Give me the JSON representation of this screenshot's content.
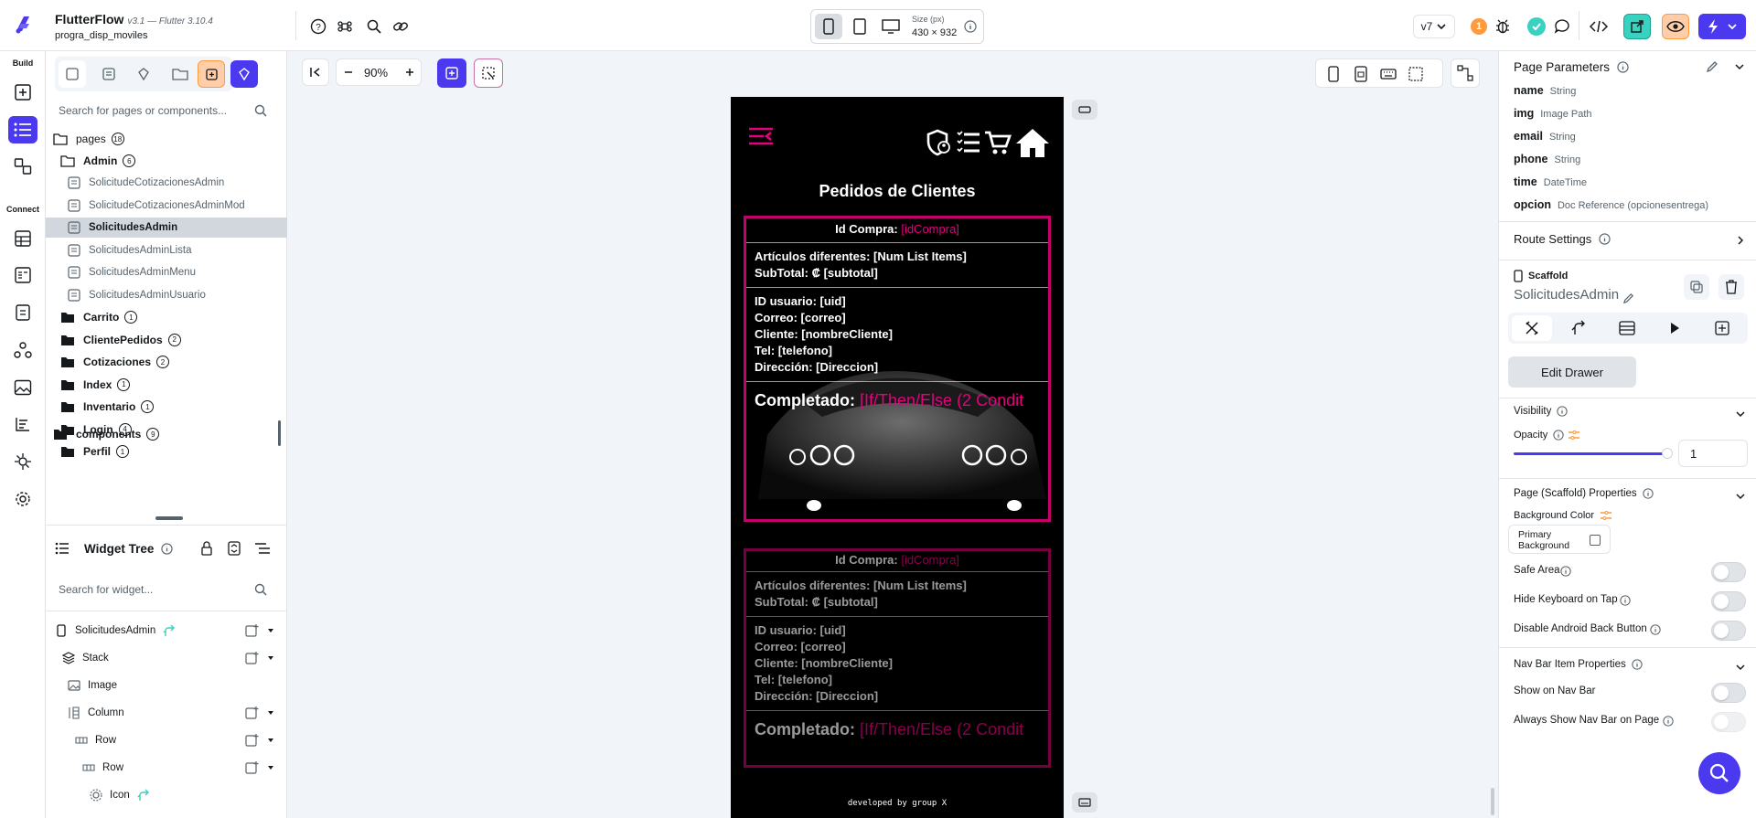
{
  "app": {
    "name": "FlutterFlow",
    "version": "v3.1 — Flutter 3.10.4",
    "project": "progra_disp_moviles"
  },
  "top_toolbar": {
    "size_label": "Size (px)",
    "size_value": "430 × 932",
    "version_select": "v7",
    "notifications_count": "1"
  },
  "rail": {
    "build_label": "Build",
    "connect_label": "Connect"
  },
  "page_tree": {
    "search_placeholder": "Search for pages or components...",
    "pages_label": "pages",
    "pages_count": "18",
    "admin_label": "Admin",
    "admin_count": "6",
    "admin_pages": [
      "SolicitudeCotizacionesAdmin",
      "SolicitudeCotizacionesAdminMod",
      "SolicitudesAdmin",
      "SolicitudesAdminLista",
      "SolicitudesAdminMenu",
      "SolicitudesAdminUsuario"
    ],
    "folders": [
      {
        "name": "Carrito",
        "count": "1"
      },
      {
        "name": "ClientePedidos",
        "count": "2"
      },
      {
        "name": "Cotizaciones",
        "count": "2"
      },
      {
        "name": "Index",
        "count": "1"
      },
      {
        "name": "Inventario",
        "count": "1"
      },
      {
        "name": "Login",
        "count": "4"
      },
      {
        "name": "Perfil",
        "count": "1"
      }
    ],
    "components_label": "components",
    "components_count": "9"
  },
  "widget_tree": {
    "title": "Widget Tree",
    "search_placeholder": "Search for widget...",
    "nodes": [
      "SolicitudesAdmin",
      "Stack",
      "Image",
      "Column",
      "Row",
      "Row",
      "Icon"
    ]
  },
  "canvas": {
    "zoom": "90%",
    "phone": {
      "title": "Pedidos de Clientes",
      "id_compra_label": "Id Compra:",
      "id_compra_value": "[idCompra]",
      "articulos": "Artículos diferentes: [Num List Items]",
      "subtotal": "SubTotal: ₡ [subtotal]",
      "id_usuario": "ID usuario: [uid]",
      "correo": "Correo: [correo]",
      "cliente": "Cliente: [nombreCliente]",
      "tel": "Tel: [telefono]",
      "direccion": "Dirección: [Direccion]",
      "completado_label": "Completado:",
      "completado_value": "[If/Then/Else (2 Condit",
      "footer": "developed by group X"
    }
  },
  "right_panel": {
    "page_parameters_title": "Page Parameters",
    "params": [
      {
        "name": "name",
        "type": "String"
      },
      {
        "name": "img",
        "type": "Image Path"
      },
      {
        "name": "email",
        "type": "String"
      },
      {
        "name": "phone",
        "type": "String"
      },
      {
        "name": "time",
        "type": "DateTime"
      },
      {
        "name": "opcion",
        "type": "Doc Reference (opcionesentrega)"
      }
    ],
    "route_settings": "Route Settings",
    "scaffold_label": "Scaffold",
    "page_name": "SolicitudesAdmin",
    "edit_drawer": "Edit Drawer",
    "visibility": "Visibility",
    "opacity_label": "Opacity",
    "opacity_value": "1",
    "scaffold_props": "Page (Scaffold) Properties",
    "bg_color_label": "Background Color",
    "bg_color_value": "Primary Background",
    "safe_area": "Safe Area",
    "hide_keyboard": "Hide Keyboard on Tap",
    "disable_back": "Disable Android Back Button",
    "nav_bar_props": "Nav Bar Item Properties",
    "show_nav": "Show on Nav Bar",
    "always_show_nav": "Always Show Nav Bar on Page"
  },
  "colors": {
    "accent": "#4b39ef",
    "pink": "#e6007e",
    "teal": "#39d2c0",
    "orange": "#ff9a3d"
  }
}
